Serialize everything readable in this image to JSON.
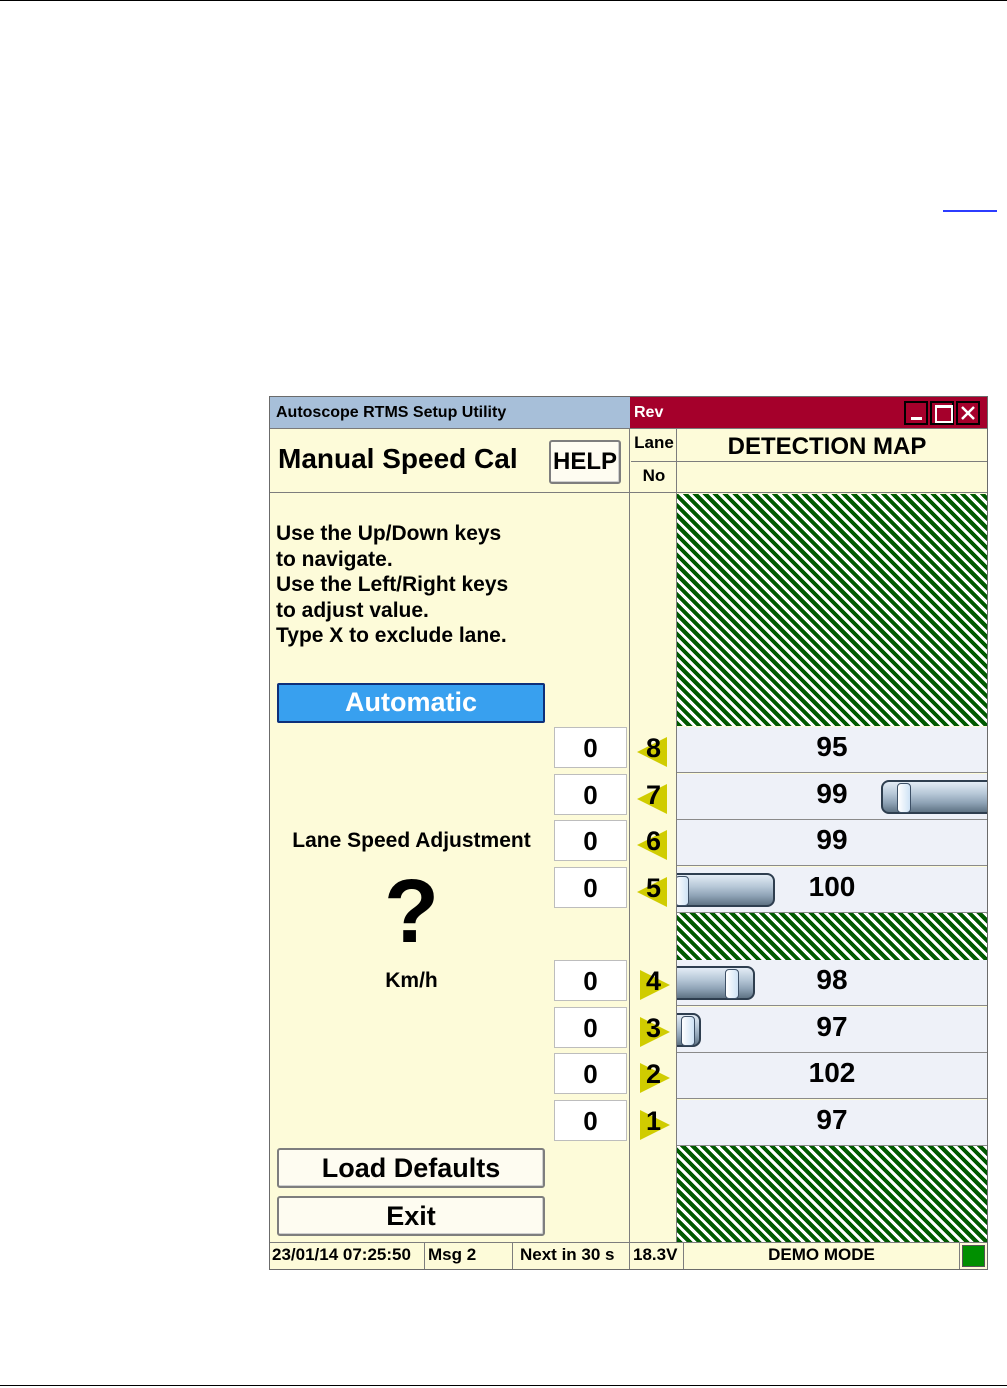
{
  "window": {
    "title": "Autoscope RTMS Setup Utility",
    "rev_label": "Rev",
    "controls": [
      "–",
      "□",
      "×"
    ]
  },
  "header": {
    "screen_title": "Manual Speed Cal",
    "help_label": "HELP",
    "lane_header_top": "Lane",
    "lane_header_bottom": "No",
    "map_title": "DETECTION MAP"
  },
  "instructions": [
    "Use the Up/Down keys",
    "to navigate.",
    "Use the Left/Right keys",
    "to adjust value.",
    "Type X to exclude lane."
  ],
  "automatic_label": "Automatic",
  "adjustment": {
    "label": "Lane Speed Adjustment",
    "value": "?",
    "unit": "Km/h"
  },
  "lanes": [
    {
      "lane": "8",
      "adjust": "0",
      "speed": "95",
      "direction": "left",
      "car": "none"
    },
    {
      "lane": "7",
      "adjust": "0",
      "speed": "99",
      "direction": "left",
      "car": "right-edge"
    },
    {
      "lane": "6",
      "adjust": "0",
      "speed": "99",
      "direction": "left",
      "car": "none"
    },
    {
      "lane": "5",
      "adjust": "0",
      "speed": "100",
      "direction": "left",
      "car": "left-long"
    },
    {
      "lane": "4",
      "adjust": "0",
      "speed": "98",
      "direction": "right",
      "car": "left-medium"
    },
    {
      "lane": "3",
      "adjust": "0",
      "speed": "97",
      "direction": "right",
      "car": "left-short"
    },
    {
      "lane": "2",
      "adjust": "0",
      "speed": "102",
      "direction": "right",
      "car": "none"
    },
    {
      "lane": "1",
      "adjust": "0",
      "speed": "97",
      "direction": "right",
      "car": "none"
    }
  ],
  "buttons": {
    "load_defaults": "Load Defaults",
    "exit": "Exit"
  },
  "status_bar": {
    "datetime": "23/01/14 07:25:50",
    "msg": "Msg 2",
    "next": "Next in 30 s",
    "voltage": "18.3V",
    "mode": "DEMO MODE"
  },
  "colors": {
    "window_bg": "#fdfbd9",
    "titlebar_left": "#a7bfd9",
    "titlebar_right": "#a5002b",
    "automatic_button": "#38a0ef",
    "hatch_green": "#005900",
    "direction_arrow": "#d0cc00",
    "status_led": "#008f00"
  }
}
